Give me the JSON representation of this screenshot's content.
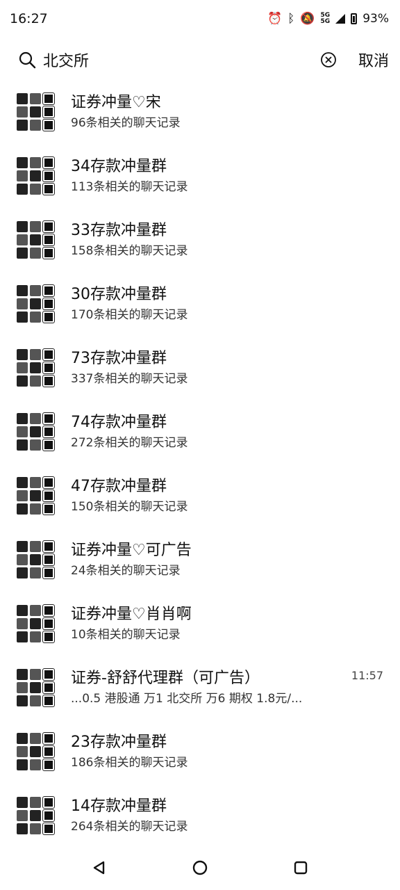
{
  "status": {
    "time": "16:27",
    "icons": [
      "alarm-icon",
      "bluetooth-icon",
      "mute-icon",
      "network-5g-icon",
      "signal-icon",
      "battery-icon"
    ],
    "net_label": "5G",
    "battery": "93%"
  },
  "search": {
    "query": "北交所",
    "cancel_label": "取消"
  },
  "results": [
    {
      "title": "证券冲量♡宋",
      "subtitle": "96条相关的聊天记录",
      "time": ""
    },
    {
      "title": "34存款冲量群",
      "subtitle": "113条相关的聊天记录",
      "time": ""
    },
    {
      "title": "33存款冲量群",
      "subtitle": "158条相关的聊天记录",
      "time": ""
    },
    {
      "title": "30存款冲量群",
      "subtitle": "170条相关的聊天记录",
      "time": ""
    },
    {
      "title": "73存款冲量群",
      "subtitle": "337条相关的聊天记录",
      "time": ""
    },
    {
      "title": "74存款冲量群",
      "subtitle": "272条相关的聊天记录",
      "time": ""
    },
    {
      "title": "47存款冲量群",
      "subtitle": "150条相关的聊天记录",
      "time": ""
    },
    {
      "title": "证券冲量♡可广告",
      "subtitle": "24条相关的聊天记录",
      "time": ""
    },
    {
      "title": "证券冲量♡肖肖啊",
      "subtitle": "10条相关的聊天记录",
      "time": ""
    },
    {
      "title": "证券-舒舒代理群（可广告）",
      "subtitle": "...0.5 港股通 万1 北交所 万6 期权 1.8元/...",
      "time": "11:57"
    },
    {
      "title": "23存款冲量群",
      "subtitle": "186条相关的聊天记录",
      "time": ""
    },
    {
      "title": "14存款冲量群",
      "subtitle": "264条相关的聊天记录",
      "time": ""
    }
  ],
  "nav": [
    "back-icon",
    "home-icon",
    "recents-icon"
  ]
}
